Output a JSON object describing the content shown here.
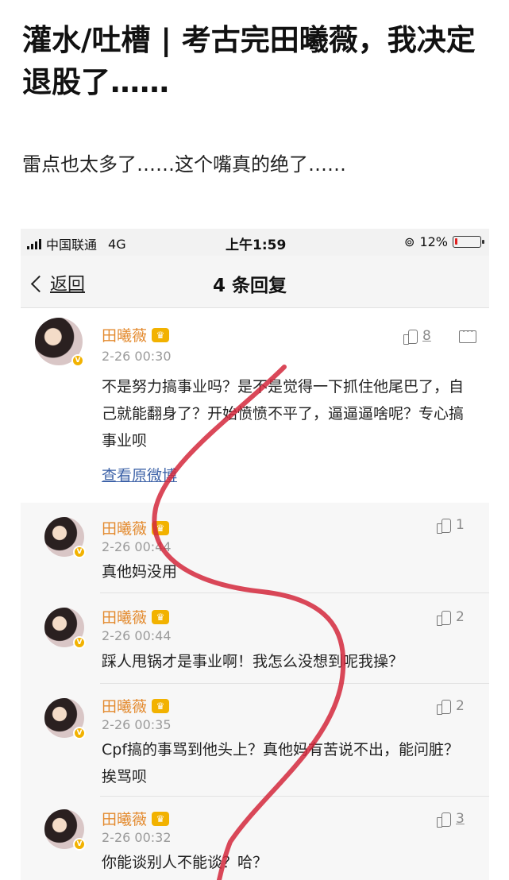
{
  "post": {
    "title": "灌水/吐槽 | 考古完田曦薇，我决定退股了……",
    "subtitle": "雷点也太多了……这个嘴真的绝了……"
  },
  "statusbar": {
    "carrier": "中国联通",
    "network": "4G",
    "time": "上午1:59",
    "battery": "12%",
    "battery_level": 0.12,
    "battery_color": "#e02020"
  },
  "navbar": {
    "back_label": "返回",
    "title": "4 条回复"
  },
  "main_comment": {
    "user": "田曦薇",
    "time": "2-26 00:30",
    "likes": "8",
    "text": "不是努力搞事业吗？是不是觉得一下抓住他尾巴了，自己就能翻身了？开始愤愤不平了，逼逼逼啥呢？专心搞事业呗",
    "view_original": "查看原微博"
  },
  "replies": [
    {
      "user": "田曦薇",
      "time": "2-26 00:44",
      "likes": "1",
      "text": "真他妈没用"
    },
    {
      "user": "田曦薇",
      "time": "2-26 00:44",
      "likes": "2",
      "text": "踩人甩锅才是事业啊！我怎么没想到呢我操？"
    },
    {
      "user": "田曦薇",
      "time": "2-26 00:35",
      "likes": "2",
      "text": "Cpf搞的事骂到他头上？真他妈有苦说不出，能问脏？挨骂呗"
    },
    {
      "user": "田曦薇",
      "time": "2-26 00:32",
      "likes": "3",
      "text": "你能谈别人不能谈？哈？"
    }
  ],
  "colors": {
    "username": "#e38a2e",
    "link": "#3e63a8",
    "scribble": "#d4283c"
  }
}
